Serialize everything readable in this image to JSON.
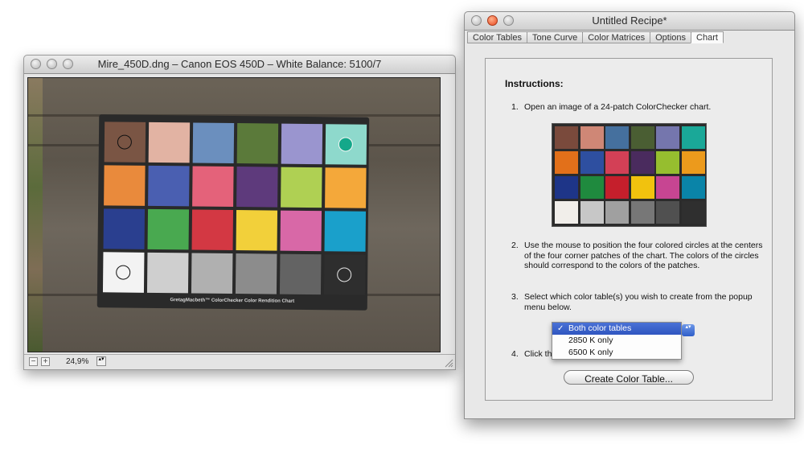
{
  "photo_window": {
    "title": "Mire_450D.dng  – Canon EOS 450D – White Balance: 5100/7",
    "chart_caption": "GretagMacbeth™ ColorChecker Color Rendition Chart",
    "zoom": "24,9%",
    "zoom_out_glyph": "−",
    "zoom_in_glyph": "+",
    "stepper_glyph": "▴▾",
    "icons": [
      "close-icon",
      "minimize-icon",
      "zoom-icon",
      "zoom-out-icon",
      "zoom-in-icon",
      "resize-grip-icon"
    ],
    "patch_colors": [
      [
        "#7a5544",
        "#e2b3a3",
        "#6b8fbe",
        "#5b7a3a",
        "#9a95cf",
        "#8ed9cc"
      ],
      [
        "#e98a3c",
        "#4a5fb1",
        "#e4627a",
        "#5e3a7c",
        "#afd053",
        "#f4a83a"
      ],
      [
        "#2a3f8f",
        "#49a950",
        "#d33843",
        "#f2d03a",
        "#d868a7",
        "#1aa0cb"
      ],
      [
        "#f3f3f3",
        "#cfcfcf",
        "#b0b0b0",
        "#8c8c8c",
        "#636363",
        "#2e2e2e"
      ]
    ],
    "circle_colors": {
      "top_left": "#7a5544",
      "top_right": "#14a88a",
      "bottom_left": "#f3f3f3",
      "bottom_right": "#2e2e2e"
    }
  },
  "recipe_window": {
    "title": "Untitled Recipe*",
    "tabs": [
      {
        "label": "Color Tables",
        "active": false
      },
      {
        "label": "Tone Curve",
        "active": false
      },
      {
        "label": "Color Matrices",
        "active": false
      },
      {
        "label": "Options",
        "active": false
      },
      {
        "label": "Chart",
        "active": true
      }
    ],
    "instructions_title": "Instructions:",
    "steps": [
      {
        "num": "1.",
        "text": "Open an image of a 24-patch ColorChecker chart."
      },
      {
        "num": "2.",
        "text": "Use the mouse to position the four colored circles at the centers of the four corner patches of the chart. The colors of the circles should correspond to the colors of the patches."
      },
      {
        "num": "3.",
        "text": "Select which color table(s) you wish to create from the popup menu below."
      },
      {
        "num": "4.",
        "text": "Click th"
      }
    ],
    "reference_colors": [
      [
        "#7a4a3c",
        "#cf8776",
        "#45709e",
        "#4a5e33",
        "#7576ad",
        "#1aa898"
      ],
      [
        "#e2701a",
        "#2e4fa0",
        "#d34056",
        "#4a2b5e",
        "#96be2f",
        "#ec9a1c"
      ],
      [
        "#1e3588",
        "#1f8a3e",
        "#c51f2c",
        "#f1c20e",
        "#c74592",
        "#0a84a8"
      ],
      [
        "#f1eeea",
        "#c7c7c7",
        "#a0a0a0",
        "#777777",
        "#505050",
        "#2f2f2f"
      ]
    ],
    "popup": {
      "options": [
        "Both color tables",
        "2850 K only",
        "6500 K only"
      ],
      "selected_index": 0,
      "check_glyph": "✓",
      "arrows_glyph": "▴▾"
    },
    "create_button": "Create Color Table..."
  }
}
